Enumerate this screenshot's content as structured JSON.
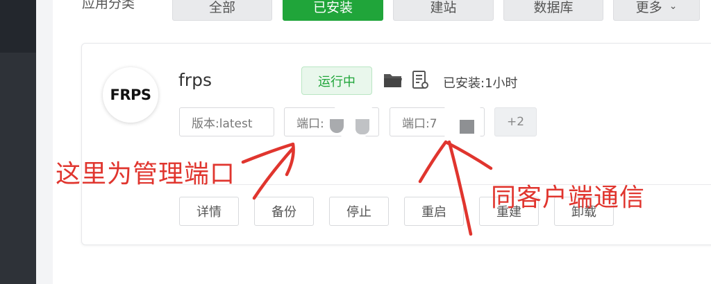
{
  "category_bar": {
    "label": "应用分类",
    "buttons": [
      {
        "label": "全部",
        "active": false
      },
      {
        "label": "已安装",
        "active": true
      },
      {
        "label": "建站",
        "active": false
      },
      {
        "label": "数据库",
        "active": false
      },
      {
        "label": "更多",
        "active": false,
        "has_dropdown": true
      }
    ]
  },
  "app": {
    "logo_text": "FRPS",
    "name": "frps",
    "status": "运行中",
    "installed": "已安装:1小时",
    "tags": [
      "版本:latest",
      "端口:",
      "端口:7"
    ],
    "more_tags": "+2",
    "actions": [
      "详情",
      "备份",
      "停止",
      "重启",
      "重建",
      "卸载"
    ]
  },
  "annotations": {
    "left": "这里为管理端口",
    "right": "同客户端通信"
  },
  "colors": {
    "accent_green": "#20a53a",
    "annotation_red": "#e0352e",
    "sidebar_dark": "#2e3238"
  },
  "icons": [
    "folder-icon",
    "log-file-icon",
    "chevron-down-icon"
  ]
}
